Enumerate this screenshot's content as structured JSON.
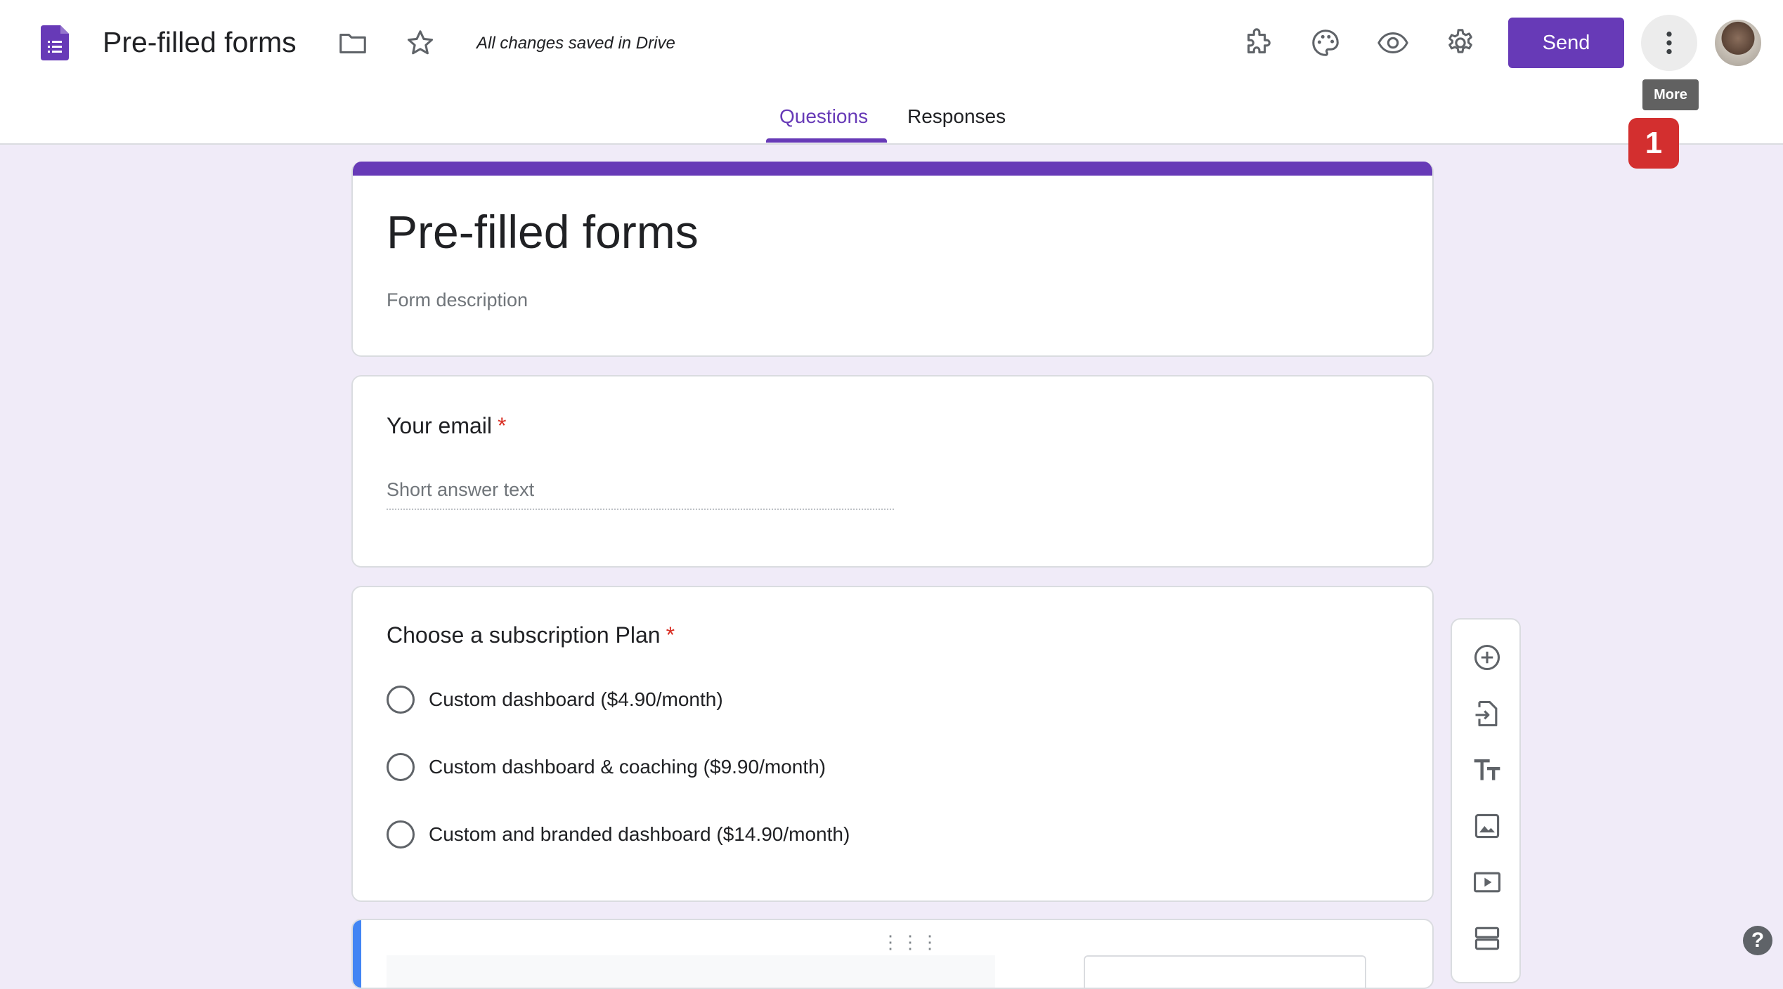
{
  "header": {
    "title": "Pre-filled forms",
    "save_status": "All changes saved in Drive",
    "send_label": "Send",
    "more_tooltip": "More",
    "icons": [
      "forms-logo-icon",
      "folder-icon",
      "star-icon",
      "addons-puzzle-icon",
      "palette-icon",
      "preview-eye-icon",
      "settings-gear-icon",
      "more-vert-icon"
    ]
  },
  "tabs": [
    {
      "label": "Questions",
      "active": true
    },
    {
      "label": "Responses",
      "active": false
    }
  ],
  "annotation": {
    "step": "1"
  },
  "form": {
    "title": "Pre-filled forms",
    "description_placeholder": "Form description",
    "questions": [
      {
        "title": "Your email",
        "required_mark": "*",
        "answer_placeholder": "Short answer text"
      },
      {
        "title": "Choose a subscription Plan",
        "required_mark": "*",
        "options": [
          "Custom dashboard ($4.90/month)",
          "Custom dashboard & coaching ($9.90/month)",
          "Custom and branded dashboard ($14.90/month)"
        ]
      }
    ]
  },
  "toolbar": {
    "tools": [
      "add-question-icon",
      "import-questions-icon",
      "add-title-icon",
      "add-image-icon",
      "add-video-icon",
      "add-section-icon"
    ]
  },
  "help": {
    "label": "?"
  },
  "colors": {
    "accent": "#673ab7",
    "background": "#f0ebf8",
    "required": "#d93025",
    "badge": "#d32f2f"
  }
}
